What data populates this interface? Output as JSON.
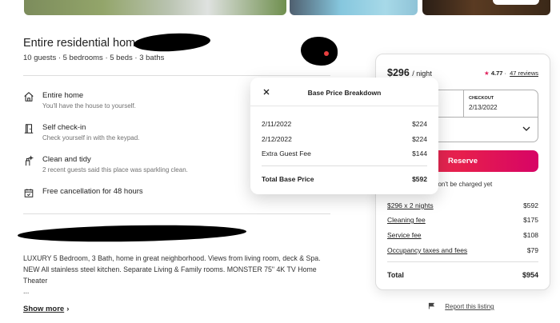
{
  "listing": {
    "title": "Entire residential home",
    "subtitle": "10 guests · 5 bedrooms · 5 beds · 3 baths"
  },
  "features": [
    {
      "icon": "house-icon",
      "title": "Entire home",
      "desc": "You'll have the house to yourself."
    },
    {
      "icon": "door-icon",
      "title": "Self check-in",
      "desc": "Check yourself in with the keypad."
    },
    {
      "icon": "sparkle-icon",
      "title": "Clean and tidy",
      "desc": "2 recent guests said this place was sparkling clean."
    },
    {
      "icon": "calendar-icon",
      "title": "Free cancellation for 48 hours",
      "desc": ""
    }
  ],
  "description": {
    "text": "LUXURY 5 Bedroom, 3 Bath, home in great neighborhood. Views from living room, deck & Spa. NEW All stainless steel kitchen. Separate Living & Family rooms. MONSTER 75\" 4K TV Home Theater",
    "ellipsis": "...",
    "show_more": "Show more"
  },
  "booking": {
    "price": "$296",
    "per_night": "/ night",
    "rating": "4.77",
    "reviews": "47 reviews",
    "checkout_label": "CHECKOUT",
    "checkout_value": "2/13/2022",
    "reserve_label": "Reserve",
    "not_charged": "won't be charged yet",
    "line_items": [
      {
        "label": "$296 x 2 nights",
        "amount": "$592"
      },
      {
        "label": "Cleaning fee",
        "amount": "$175"
      },
      {
        "label": "Service fee",
        "amount": "$108"
      },
      {
        "label": "Occupancy taxes and fees",
        "amount": "$79"
      }
    ],
    "total_label": "Total",
    "total_amount": "$954"
  },
  "report": {
    "label": "Report this listing"
  },
  "modal": {
    "title": "Base Price Breakdown",
    "rows": [
      {
        "label": "2/11/2022",
        "amount": "$224"
      },
      {
        "label": "2/12/2022",
        "amount": "$224"
      },
      {
        "label": "Extra Guest Fee",
        "amount": "$144"
      }
    ],
    "total_label": "Total Base Price",
    "total_amount": "$592"
  },
  "colors": {
    "accent": "#e61e4d",
    "star": "#e0245e"
  }
}
